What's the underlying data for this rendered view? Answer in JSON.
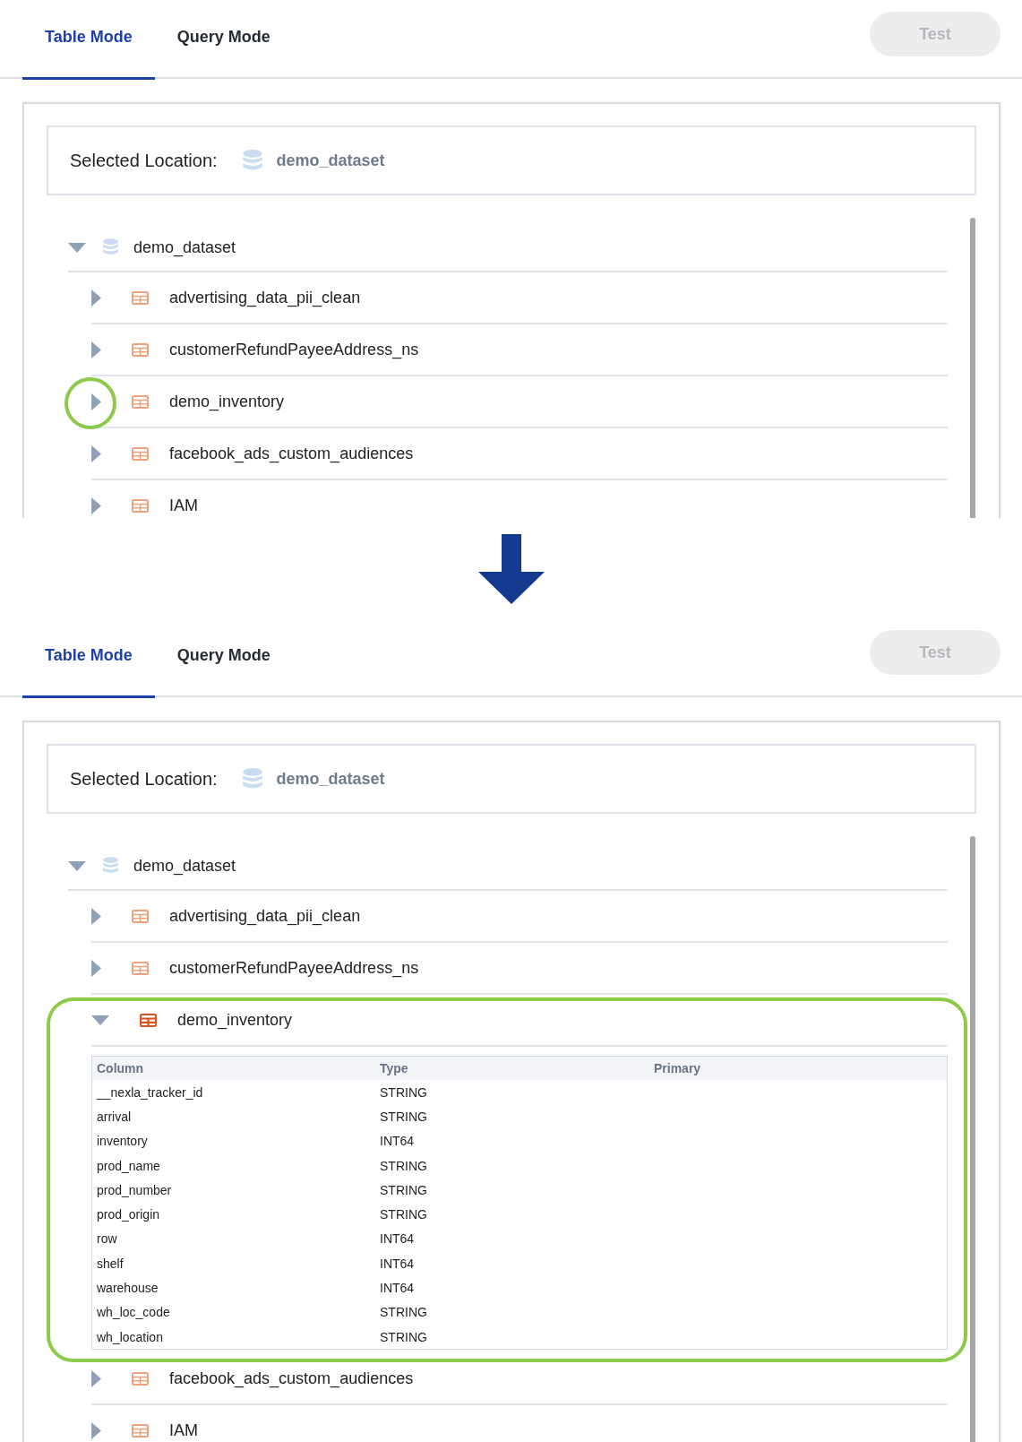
{
  "panels": [
    {
      "tabs": [
        {
          "label": "Table Mode",
          "selected": true
        },
        {
          "label": "Query Mode",
          "selected": false
        }
      ],
      "test_button": {
        "label": "Test",
        "disabled": true
      },
      "selected_location": {
        "label": "Selected Location:",
        "value": "demo_dataset"
      },
      "tree": {
        "label": "demo_dataset",
        "expanded": true,
        "children": [
          {
            "label": "advertising_data_pii_clean",
            "expanded": false,
            "highlighted": false
          },
          {
            "label": "customerRefundPayeeAddress_ns",
            "expanded": false,
            "highlighted": false
          },
          {
            "label": "demo_inventory",
            "expanded": false,
            "highlighted": true
          },
          {
            "label": "facebook_ads_custom_audiences",
            "expanded": false,
            "highlighted": false
          },
          {
            "label": "IAM",
            "expanded": false,
            "highlighted": false
          }
        ]
      }
    },
    {
      "tabs": [
        {
          "label": "Table Mode",
          "selected": true
        },
        {
          "label": "Query Mode",
          "selected": false
        }
      ],
      "test_button": {
        "label": "Test",
        "disabled": true
      },
      "selected_location": {
        "label": "Selected Location:",
        "value": "demo_dataset"
      },
      "tree": {
        "label": "demo_dataset",
        "expanded": true,
        "children": [
          {
            "label": "advertising_data_pii_clean",
            "expanded": false,
            "highlighted": false
          },
          {
            "label": "customerRefundPayeeAddress_ns",
            "expanded": false,
            "highlighted": false
          },
          {
            "label": "demo_inventory",
            "expanded": true,
            "highlighted": true,
            "schema": {
              "headers": [
                "Column",
                "Type",
                "Primary"
              ],
              "rows": [
                {
                  "column": "__nexla_tracker_id",
                  "type": "STRING"
                },
                {
                  "column": "arrival",
                  "type": "STRING"
                },
                {
                  "column": "inventory",
                  "type": "INT64"
                },
                {
                  "column": "prod_name",
                  "type": "STRING"
                },
                {
                  "column": "prod_number",
                  "type": "STRING"
                },
                {
                  "column": "prod_origin",
                  "type": "STRING"
                },
                {
                  "column": "row",
                  "type": "INT64"
                },
                {
                  "column": "shelf",
                  "type": "INT64"
                },
                {
                  "column": "warehouse",
                  "type": "INT64"
                },
                {
                  "column": "wh_loc_code",
                  "type": "STRING"
                },
                {
                  "column": "wh_location",
                  "type": "STRING"
                }
              ]
            }
          },
          {
            "label": "facebook_ads_custom_audiences",
            "expanded": false,
            "highlighted": false
          },
          {
            "label": "IAM",
            "expanded": false,
            "highlighted": false
          }
        ]
      }
    }
  ]
}
